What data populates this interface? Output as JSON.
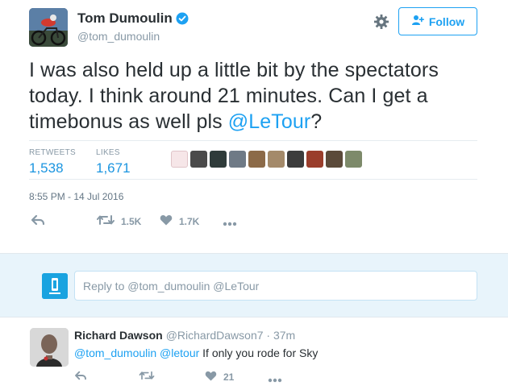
{
  "tweet": {
    "author": {
      "name": "Tom Dumoulin",
      "handle": "@tom_dumoulin",
      "verified": true
    },
    "follow_label": "Follow",
    "text_parts": {
      "line": "I was also held up a little bit by the spectators today. I think around 21 minutes. Can I get a timebonus as well pls ",
      "mention": "@LeTour",
      "tail": "?"
    },
    "stats": {
      "retweets_label": "RETWEETS",
      "retweets_value": "1,538",
      "likes_label": "LIKES",
      "likes_value": "1,671"
    },
    "timestamp": "8:55 PM - 14 Jul 2016",
    "actions": {
      "retweet_count": "1.5K",
      "like_count": "1.7K"
    }
  },
  "reply_box": {
    "placeholder": "Reply to @tom_dumoulin @LeTour"
  },
  "reply": {
    "name": "Richard Dawson",
    "handle": "@RichardDawson7",
    "sep": " · ",
    "time": "37m",
    "mention1": "@tom_dumoulin",
    "mention2": "@letour",
    "text": " If only you rode for Sky",
    "like_count": "21"
  },
  "colors": {
    "accent": "#1da1f2",
    "muted": "#8899a6",
    "text": "#292f33",
    "reply_bg": "#e8f4fb"
  },
  "icons": [
    "verified-badge-icon",
    "gear-icon",
    "follow-person-plus-icon",
    "reply-arrow-icon",
    "retweet-icon",
    "heart-icon",
    "more-dots-icon"
  ]
}
